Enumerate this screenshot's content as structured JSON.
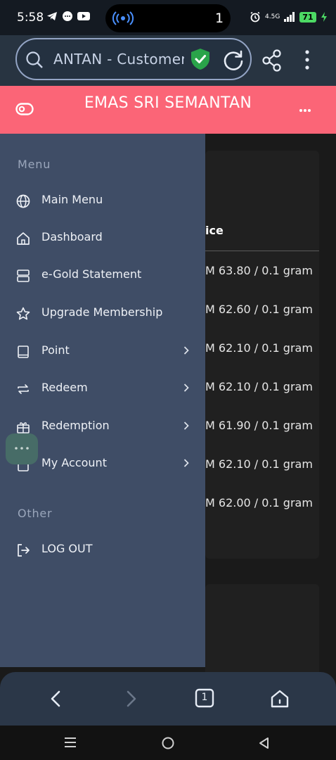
{
  "status_bar": {
    "time": "5:58",
    "island_count": "1",
    "network": "4.5G",
    "battery": "71"
  },
  "browser": {
    "url_text": "ANTAN - Customer"
  },
  "header": {
    "title": "EMAS SRI SEMANTAN"
  },
  "content": {
    "column_header": "ice",
    "prices": [
      "M 63.80 / 0.1 gram",
      "M 62.60 / 0.1 gram",
      "M 62.10 / 0.1 gram",
      "M 62.10 / 0.1 gram",
      "M 61.90 / 0.1 gram",
      "M 62.10 / 0.1 gram",
      "M 62.00 / 0.1 gram"
    ]
  },
  "sidebar": {
    "menu_label": "Menu",
    "other_label": "Other",
    "items": [
      {
        "label": "Main Menu",
        "icon": "globe-icon"
      },
      {
        "label": "Dashboard",
        "icon": "home-icon"
      },
      {
        "label": "e-Gold Statement",
        "icon": "server-icon"
      },
      {
        "label": "Upgrade Membership",
        "icon": "star-icon"
      },
      {
        "label": "Point",
        "icon": "book-icon",
        "has_submenu": true
      },
      {
        "label": "Redeem",
        "icon": "exchange-icon",
        "has_submenu": true
      },
      {
        "label": "Redemption",
        "icon": "gift-icon",
        "has_submenu": true
      },
      {
        "label": "My Account",
        "icon": "lock-icon",
        "has_submenu": true
      }
    ],
    "logout_label": "LOG OUT"
  },
  "bottom_nav": {
    "tab_count": "1"
  },
  "colors": {
    "header": "#fb6577",
    "sidebar": "#3f4d66",
    "accent_green": "#2aa44a"
  }
}
